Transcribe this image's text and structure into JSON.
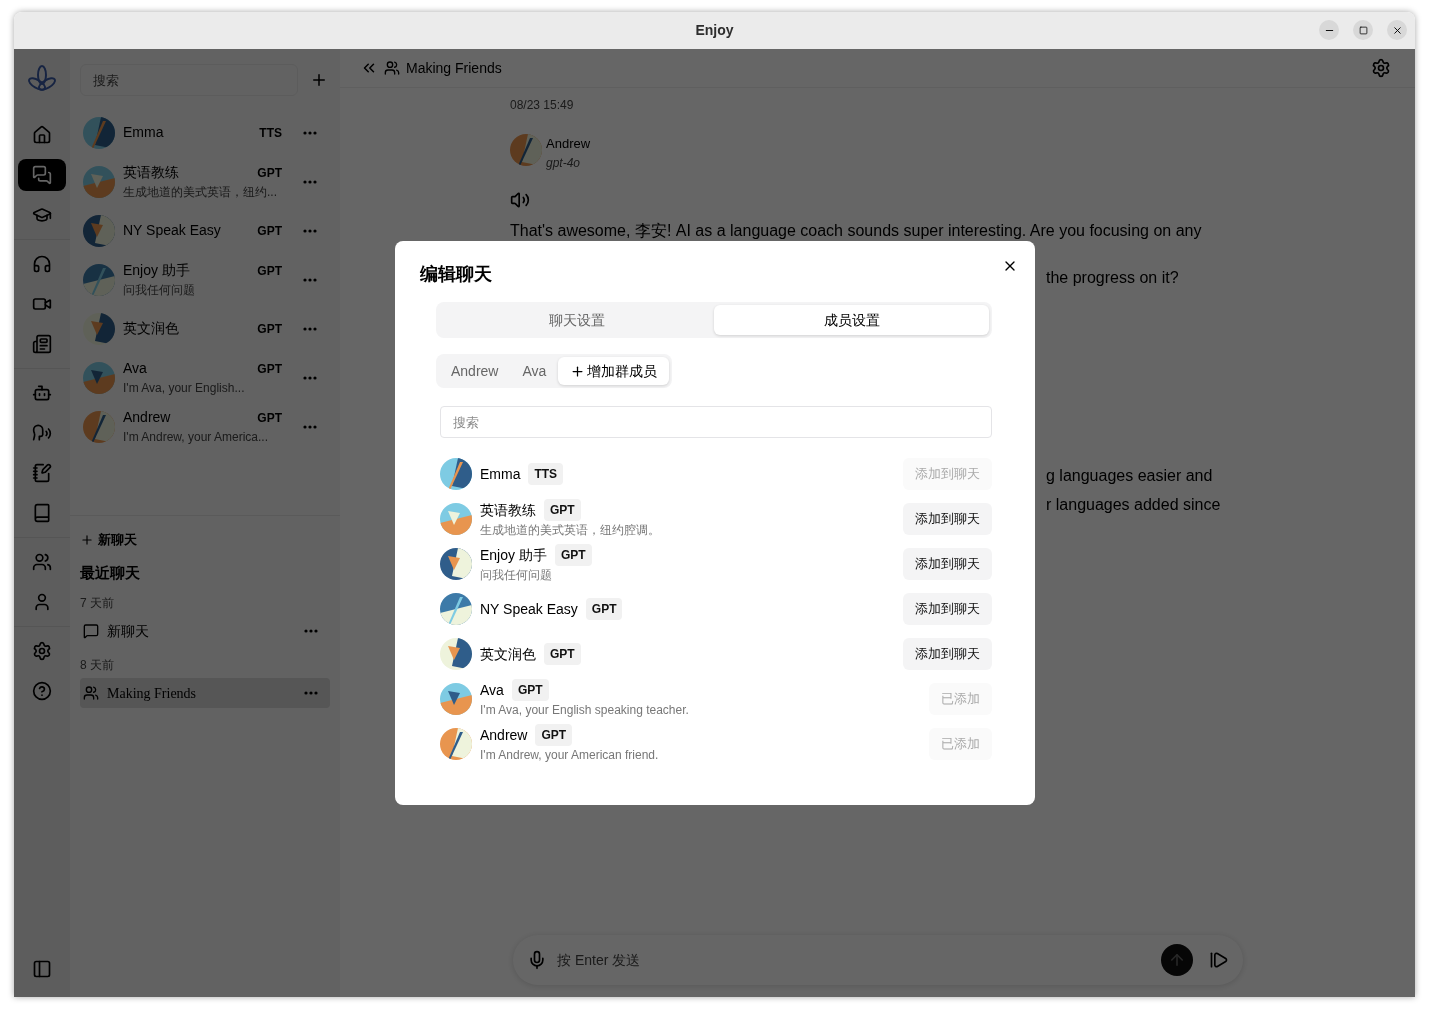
{
  "window": {
    "title": "Enjoy"
  },
  "nav_items": [
    {
      "selected": false
    },
    {
      "selected": true
    },
    {
      "selected": false
    },
    {
      "selected": false
    },
    {
      "selected": false
    },
    {
      "selected": false
    },
    {
      "selected": false
    },
    {
      "selected": false
    },
    {
      "selected": false
    },
    {
      "selected": false
    },
    {
      "selected": false
    },
    {
      "selected": false
    },
    {
      "selected": false
    },
    {
      "selected": false
    }
  ],
  "chat_list": {
    "search": {
      "placeholder": "搜索"
    },
    "agents": [
      {
        "name": "Emma",
        "badge": "TTS"
      },
      {
        "name": "英语教练",
        "badge": "GPT",
        "subtitle": "生成地道的美式英语，纽约..."
      },
      {
        "name": "NY Speak Easy",
        "badge": "GPT"
      },
      {
        "name": "Enjoy 助手",
        "badge": "GPT",
        "subtitle": "问我任何问题"
      },
      {
        "name": "英文润色",
        "badge": "GPT"
      },
      {
        "name": "Ava",
        "badge": "GPT",
        "subtitle": "I'm Ava, your English..."
      },
      {
        "name": "Andrew",
        "badge": "GPT",
        "subtitle": "I'm Andrew, your America..."
      }
    ],
    "new_chat": "新聊天",
    "recent_title": "最近聊天",
    "groups": [
      {
        "label": "7 天前",
        "chats": [
          {
            "title": "新聊天",
            "kind": "single",
            "selected": false
          }
        ]
      },
      {
        "label": "8 天前",
        "chats": [
          {
            "title": "Making Friends",
            "kind": "group",
            "selected": true
          }
        ]
      }
    ]
  },
  "header": {
    "title": "Making Friends"
  },
  "message": {
    "timestamp": "08/23 15:49",
    "author": "Andrew",
    "model": "gpt-4o",
    "lines": [
      "That's awesome, 李安! AI as a language coach sounds super interesting. Are you focusing on any",
      "the progress on it?",
      "g languages easier and",
      "r languages added since"
    ]
  },
  "composer": {
    "placeholder": "按 Enter 发送"
  },
  "dialog": {
    "title": "编辑聊天",
    "tabs": [
      {
        "label": "聊天设置",
        "selected": false
      },
      {
        "label": "成员设置",
        "selected": true
      }
    ],
    "member_tabs": [
      {
        "label": "Andrew",
        "selected": false,
        "kind": "member"
      },
      {
        "label": "Ava",
        "selected": false,
        "kind": "member"
      },
      {
        "label": "增加群成员",
        "selected": true,
        "kind": "add"
      }
    ],
    "search": {
      "placeholder": "搜索"
    },
    "agents": [
      {
        "name": "Emma",
        "badge": "TTS",
        "action": "添加到聊天",
        "disabled": true
      },
      {
        "name": "英语教练",
        "badge": "GPT",
        "subtitle": "生成地道的美式英语，纽约腔调。",
        "action": "添加到聊天",
        "disabled": false
      },
      {
        "name": "Enjoy 助手",
        "badge": "GPT",
        "subtitle": "问我任何问题",
        "action": "添加到聊天",
        "disabled": false
      },
      {
        "name": "NY Speak Easy",
        "badge": "GPT",
        "action": "添加到聊天",
        "disabled": false
      },
      {
        "name": "英文润色",
        "badge": "GPT",
        "action": "添加到聊天",
        "disabled": false
      },
      {
        "name": "Ava",
        "badge": "GPT",
        "subtitle": "I'm Ava, your English speaking teacher.",
        "action": "已添加",
        "disabled": true
      },
      {
        "name": "Andrew",
        "badge": "GPT",
        "subtitle": "I'm Andrew, your American friend.",
        "action": "已添加",
        "disabled": true
      }
    ]
  }
}
